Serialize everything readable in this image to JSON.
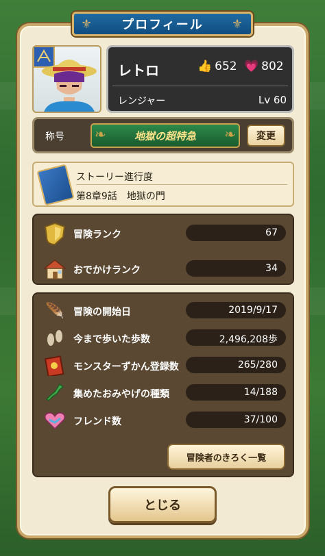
{
  "window": {
    "title": "プロフィール"
  },
  "player": {
    "name": "レトロ",
    "likes": "652",
    "hearts": "802",
    "job": "レンジャー",
    "level": "Lv 60"
  },
  "title_section": {
    "label": "称号",
    "emblem_text": "地獄の超特急",
    "change_button": "変更"
  },
  "story": {
    "heading": "ストーリー進行度",
    "value": "第8章9話　地獄の門"
  },
  "ranks": [
    {
      "label": "冒険ランク",
      "value": "67",
      "icon": "shield-icon"
    },
    {
      "label": "おでかけランク",
      "value": "34",
      "icon": "house-icon"
    }
  ],
  "stats": [
    {
      "label": "冒険の開始日",
      "value": "2019/9/17",
      "icon": "quill-icon"
    },
    {
      "label": "今まで歩いた歩数",
      "value": "2,496,208歩",
      "icon": "footprints-icon"
    },
    {
      "label": "モンスターずかん登録数",
      "value": "265/280",
      "icon": "monster-book-icon"
    },
    {
      "label": "集めたおみやげの種類",
      "value": "14/188",
      "icon": "japan-map-icon"
    },
    {
      "label": "フレンド数",
      "value": "37/100",
      "icon": "handshake-icon"
    }
  ],
  "buttons": {
    "record": "冒険者のきろく一覧",
    "close": "とじる"
  },
  "colors": {
    "title_plate": "#1e6aa2",
    "panel_bg": "#5a4832",
    "frame_bg": "#f3ead3",
    "gold_trim": "#caa86a"
  }
}
